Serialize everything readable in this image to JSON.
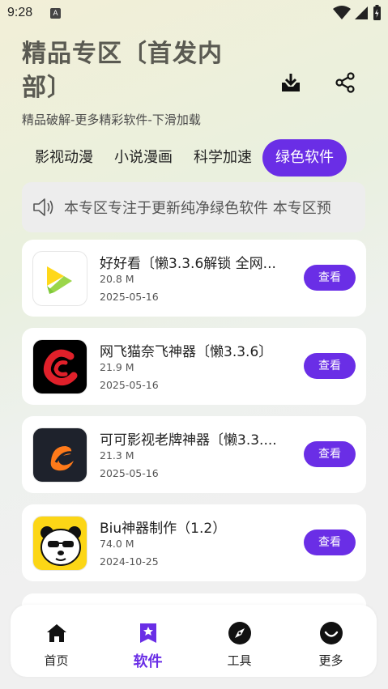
{
  "status": {
    "time": "9:28",
    "a_badge": "A"
  },
  "header": {
    "title": "精品专区〔首发内部〕",
    "subtitle": "精品破解-更多精彩软件-下滑加载"
  },
  "tabs": [
    {
      "label": "影视动漫",
      "active": false
    },
    {
      "label": "小说漫画",
      "active": false
    },
    {
      "label": "科学加速",
      "active": false
    },
    {
      "label": "绿色软件",
      "active": true
    }
  ],
  "notice": {
    "text": "本专区专注于更新纯净绿色软件   本专区预"
  },
  "apps": [
    {
      "name": "好好看〔懒3.3.6解锁 全网...",
      "size": "20.8 M",
      "date": "2025-05-16",
      "button": "查看",
      "icon": "yellow-play-logo"
    },
    {
      "name": "网飞猫奈飞神器〔懒3.3.6〕",
      "size": "21.9 M",
      "date": "2025-05-16",
      "button": "查看",
      "icon": "red-c-logo"
    },
    {
      "name": "可可影视老牌神器〔懒3.3....",
      "size": "21.3 M",
      "date": "2025-05-16",
      "button": "查看",
      "icon": "orange-swirl-logo"
    },
    {
      "name": "Biu神器制作（1.2）",
      "size": "74.0 M",
      "date": "2024-10-25",
      "button": "查看",
      "icon": "panda-logo"
    }
  ],
  "nav": [
    {
      "label": "首页",
      "icon": "home-icon",
      "active": false
    },
    {
      "label": "软件",
      "icon": "software-star-icon",
      "active": true
    },
    {
      "label": "工具",
      "icon": "compass-icon",
      "active": false
    },
    {
      "label": "更多",
      "icon": "smile-icon",
      "active": false
    }
  ],
  "colors": {
    "accent": "#6a2ee6"
  }
}
